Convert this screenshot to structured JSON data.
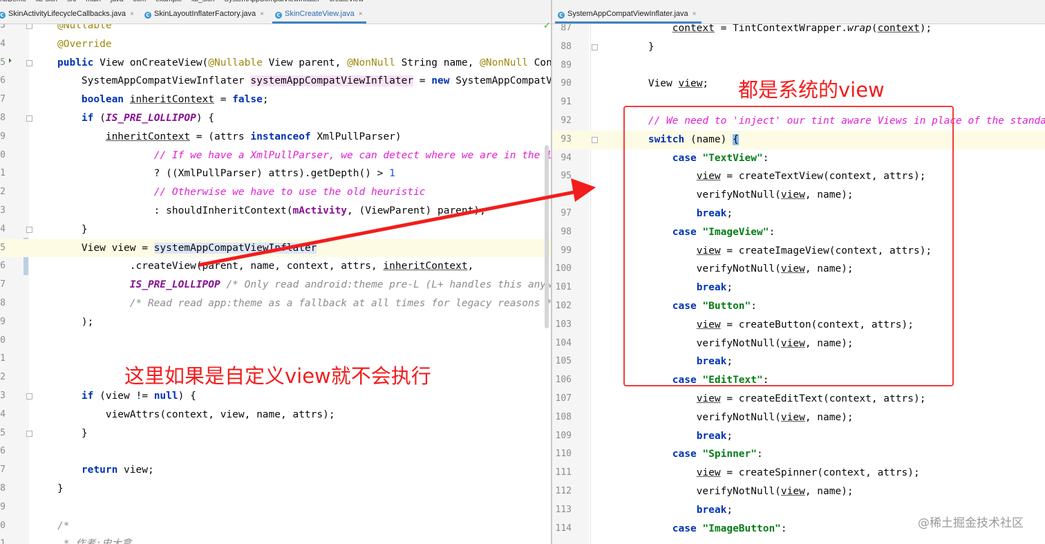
{
  "breadcrumb": [
    "nbDemo",
    "lib-skin",
    "src",
    "main",
    "java",
    "com",
    "example",
    "lib_skin",
    "SystemAppCompatViewInflater",
    "createView"
  ],
  "left_tabs": [
    {
      "label": "SkinActivityLifecycleCallbacks.java",
      "active": false
    },
    {
      "label": "SkinLayoutInflaterFactory.java",
      "active": false
    },
    {
      "label": "SkinCreateView.java",
      "active": true
    }
  ],
  "right_tabs": [
    {
      "label": "SystemAppCompatViewInflater.java",
      "active": true
    }
  ],
  "tab_close_glyph": "×",
  "tab_file_icon": "C",
  "left_line_numbers": [
    "3",
    "4",
    "5",
    "6",
    "7",
    "8",
    "9",
    "0",
    "1",
    "2",
    "3",
    "4",
    "5",
    "6",
    "7",
    "8",
    "9",
    "0",
    "1",
    "2",
    "3",
    "4",
    "5",
    "6",
    "7",
    "8",
    "9",
    "0",
    "1"
  ],
  "right_line_numbers": [
    "87",
    "88",
    "89",
    "90",
    "91",
    "92",
    "93",
    "94",
    "95",
    "",
    "97",
    "98",
    "99",
    "100",
    "101",
    "102",
    "103",
    "104",
    "105",
    "106",
    "107",
    "108",
    "109",
    "110",
    "111",
    "112",
    "113",
    "114"
  ],
  "annotations": {
    "left_caption": "这里如果是自定义view就不会执行",
    "right_caption": "都是系统的view"
  },
  "watermark": "@稀土掘金技术社区",
  "status_icons": {
    "inspection": "✓",
    "run_gutter": "⏵"
  },
  "colors": {
    "arrow": "#f21d1d",
    "box": "#f23b3b",
    "keyword": "#0033b3",
    "string": "#067d17",
    "comment": "#e01fd2"
  }
}
